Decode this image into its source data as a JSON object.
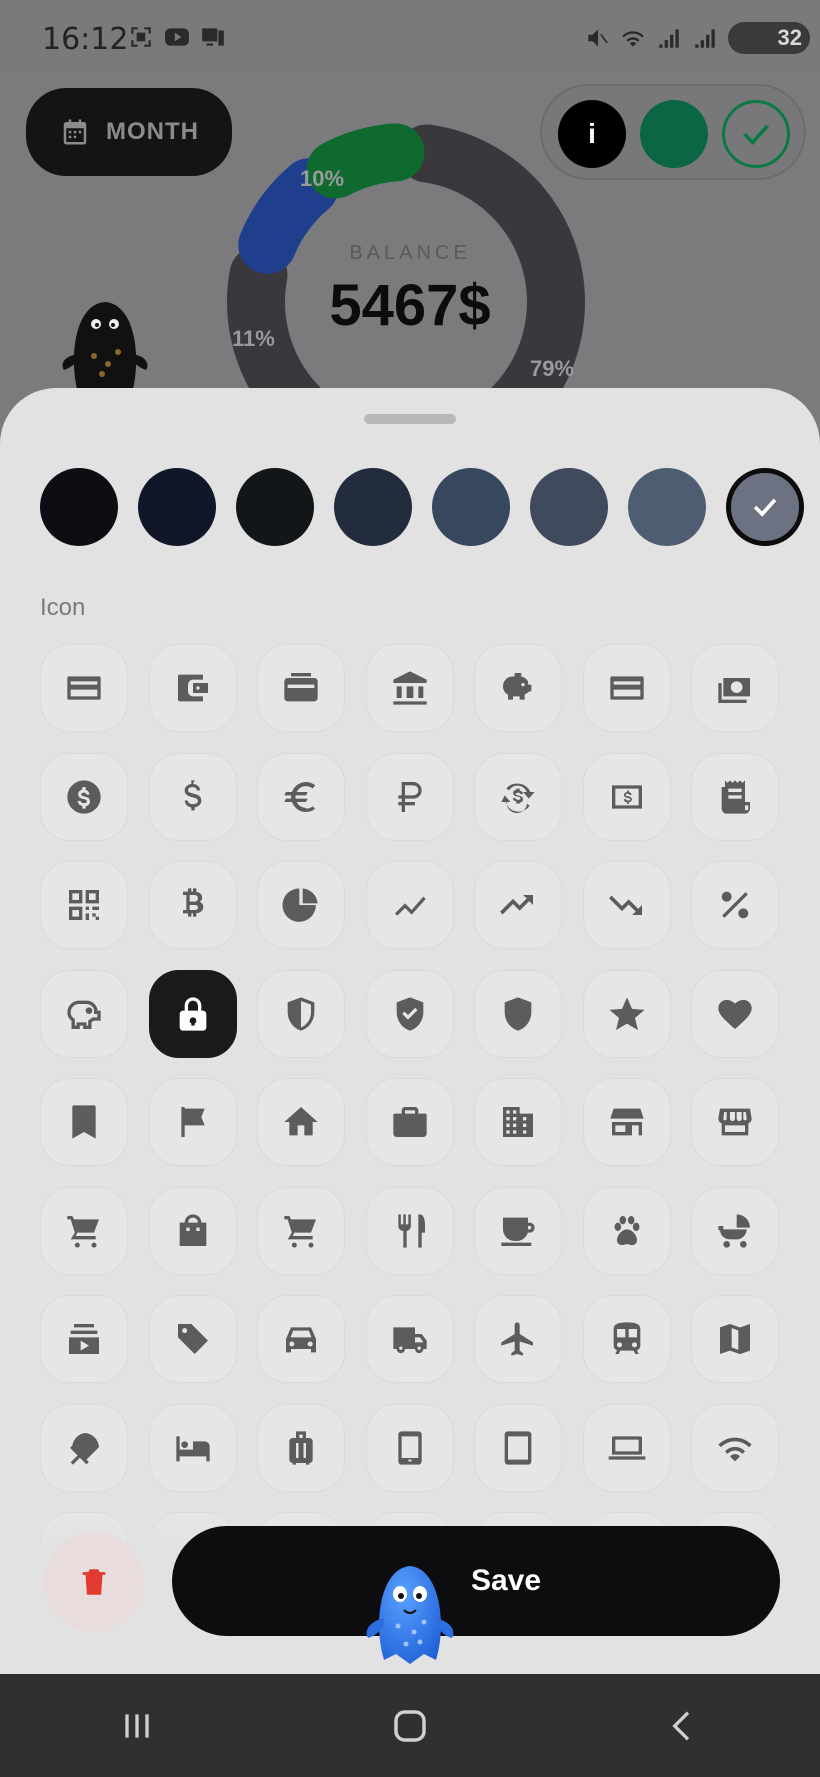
{
  "status_bar": {
    "time": "16:12",
    "battery": "32",
    "left_icons": [
      "screenshot-icon",
      "youtube-icon",
      "device-icon"
    ],
    "right_icons": [
      "mute-icon",
      "wifi-icon",
      "signal-icon",
      "signal-icon"
    ]
  },
  "header": {
    "month_button_label": "MONTH",
    "toggle_info_label": "i"
  },
  "balance": {
    "label": "BALANCE",
    "value": "5467$",
    "segments": [
      {
        "label": "10%",
        "value": 10,
        "color": "#0f6a30"
      },
      {
        "label": "11%",
        "value": 11,
        "color": "#1f3f8c"
      },
      {
        "label": "79%",
        "value": 79,
        "color": "#39393d"
      }
    ]
  },
  "sheet": {
    "colors": [
      "#0c0e14",
      "#111729",
      "#131619",
      "#232c3c",
      "#37475d",
      "#404a5d",
      "#4e5d72",
      "#6c7281"
    ],
    "selected_color_index": 7,
    "icon_section_label": "Icon",
    "icons": [
      "credit-card-icon",
      "wallet-icon",
      "wallet-alt-icon",
      "bank-icon",
      "piggy-bank-icon",
      "card-icon",
      "money-stack-icon",
      "dollar-circle-icon",
      "dollar-icon",
      "euro-icon",
      "ruble-icon",
      "currency-exchange-icon",
      "cash-icon",
      "receipt-icon",
      "qr-code-icon",
      "bitcoin-icon",
      "pie-chart-icon",
      "line-chart-icon",
      "trending-up-icon",
      "trending-down-icon",
      "percent-icon",
      "savings-icon",
      "lock-icon",
      "shield-half-icon",
      "shield-check-icon",
      "shield-icon",
      "star-icon",
      "heart-icon",
      "bookmark-icon",
      "flag-icon",
      "home-icon",
      "briefcase-icon",
      "building-icon",
      "store-icon",
      "storefront-icon",
      "shopping-cart-icon",
      "shopping-bag-icon",
      "cart-icon",
      "restaurant-icon",
      "coffee-icon",
      "paw-icon",
      "stroller-icon",
      "subscriptions-icon",
      "tag-icon",
      "car-icon",
      "truck-icon",
      "airplane-icon",
      "train-icon",
      "map-icon",
      "beach-umbrella-icon",
      "bed-icon",
      "luggage-icon",
      "smartphone-icon",
      "tablet-icon",
      "laptop-icon",
      "wifi-icon"
    ],
    "selected_icon_index": 22,
    "save_label": "Save",
    "delete_icon": "trash-icon"
  },
  "nav": [
    "recents-icon",
    "home-icon",
    "back-icon"
  ]
}
